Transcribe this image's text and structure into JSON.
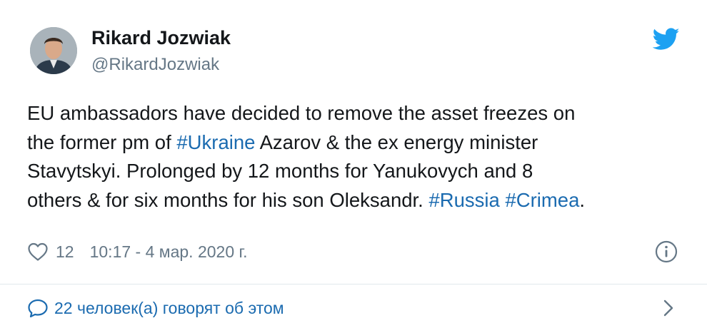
{
  "author": {
    "name": "Rikard Jozwiak",
    "handle": "@RikardJozwiak",
    "avatar_icon": "profile-photo"
  },
  "platform_icon": "twitter-bird-icon",
  "tweet": {
    "line1": "EU ambassadors have decided to remove the asset freezes on",
    "line2_before": "the former pm of ",
    "line2_tag": "#Ukraine",
    "line2_after": " Azarov & the ex energy minister",
    "line3": "Stavytskyi. Prolonged by 12 months for Yanukovych and 8",
    "line4_before": "others & for six months for his son Oleksandr. ",
    "tag_russia": "#Russia",
    "tag_crimea": "#Crimea",
    "line4_end": "."
  },
  "meta": {
    "like_icon": "heart-icon",
    "likes": "12",
    "timestamp": "10:17 - 4 мар. 2020 г.",
    "info_icon": "info-icon"
  },
  "conversation": {
    "icon": "speech-bubble-icon",
    "text": "22 человек(а) говорят об этом",
    "chevron_icon": "chevron-right-icon"
  },
  "colors": {
    "link": "#1b6bb0",
    "twitter_blue": "#1da1f2",
    "muted": "#657786",
    "text": "#14171a",
    "divider": "#e1e8ed"
  }
}
